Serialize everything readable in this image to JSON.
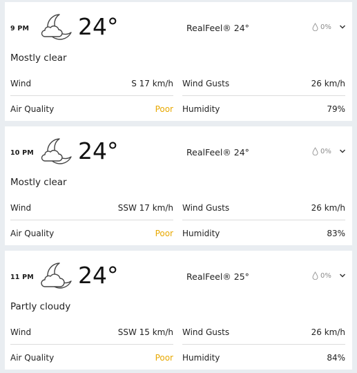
{
  "hours": [
    {
      "time": "9 PM",
      "icon": "night-mostly-clear-icon",
      "temp": "24°",
      "realfeel": "RealFeel® 24°",
      "precip": "0%",
      "phrase": "Mostly clear",
      "wind_label": "Wind",
      "wind_value": "S 17 km/h",
      "gusts_label": "Wind Gusts",
      "gusts_value": "26 km/h",
      "aq_label": "Air Quality",
      "aq_value": "Poor",
      "humidity_label": "Humidity",
      "humidity_value": "79%"
    },
    {
      "time": "10 PM",
      "icon": "night-mostly-clear-icon",
      "temp": "24°",
      "realfeel": "RealFeel® 24°",
      "precip": "0%",
      "phrase": "Mostly clear",
      "wind_label": "Wind",
      "wind_value": "SSW 17 km/h",
      "gusts_label": "Wind Gusts",
      "gusts_value": "26 km/h",
      "aq_label": "Air Quality",
      "aq_value": "Poor",
      "humidity_label": "Humidity",
      "humidity_value": "83%"
    },
    {
      "time": "11 PM",
      "icon": "night-partly-cloudy-icon",
      "temp": "24°",
      "realfeel": "RealFeel® 25°",
      "precip": "0%",
      "phrase": "Partly cloudy",
      "wind_label": "Wind",
      "wind_value": "SSW 15 km/h",
      "gusts_label": "Wind Gusts",
      "gusts_value": "26 km/h",
      "aq_label": "Air Quality",
      "aq_value": "Poor",
      "humidity_label": "Humidity",
      "humidity_value": "84%"
    }
  ],
  "colors": {
    "background": "#e9edf1",
    "card": "#ffffff",
    "air_quality_poor": "#e8a800",
    "muted": "#8a8a8a"
  }
}
